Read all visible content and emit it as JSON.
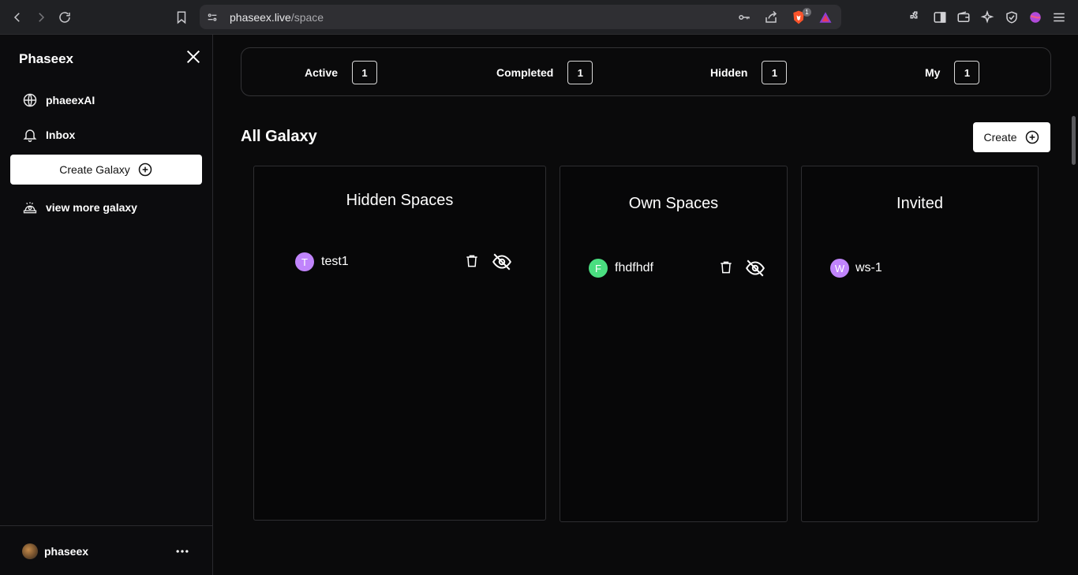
{
  "browser": {
    "url_host": "phaseex.live",
    "url_path": "/space",
    "shield_badge": "1"
  },
  "sidebar": {
    "brand": "Phaseex",
    "items": [
      {
        "label": "phaeexAI",
        "icon": "globe-icon"
      },
      {
        "label": "Inbox",
        "icon": "bell-icon"
      }
    ],
    "create_button": "Create Galaxy",
    "view_more": "view more galaxy",
    "user_name": "phaseex"
  },
  "stats": [
    {
      "label": "Active",
      "count": "1"
    },
    {
      "label": "Completed",
      "count": "1"
    },
    {
      "label": "Hidden",
      "count": "1"
    },
    {
      "label": "My",
      "count": "1"
    }
  ],
  "main": {
    "title": "All Galaxy",
    "create_label": "Create"
  },
  "panels": [
    {
      "title": "Hidden Spaces",
      "spaces": [
        {
          "initial": "T",
          "name": "test1",
          "color": "#c084fc",
          "actions": [
            "trash-icon",
            "eye-off-icon"
          ]
        }
      ]
    },
    {
      "title": "Own Spaces",
      "spaces": [
        {
          "initial": "F",
          "name": "fhdfhdf",
          "color": "#4ade80",
          "actions": [
            "trash-icon",
            "eye-off-icon"
          ]
        }
      ]
    },
    {
      "title": "Invited",
      "spaces": [
        {
          "initial": "W",
          "name": "ws-1",
          "color": "#c084fc",
          "actions": []
        }
      ]
    }
  ]
}
